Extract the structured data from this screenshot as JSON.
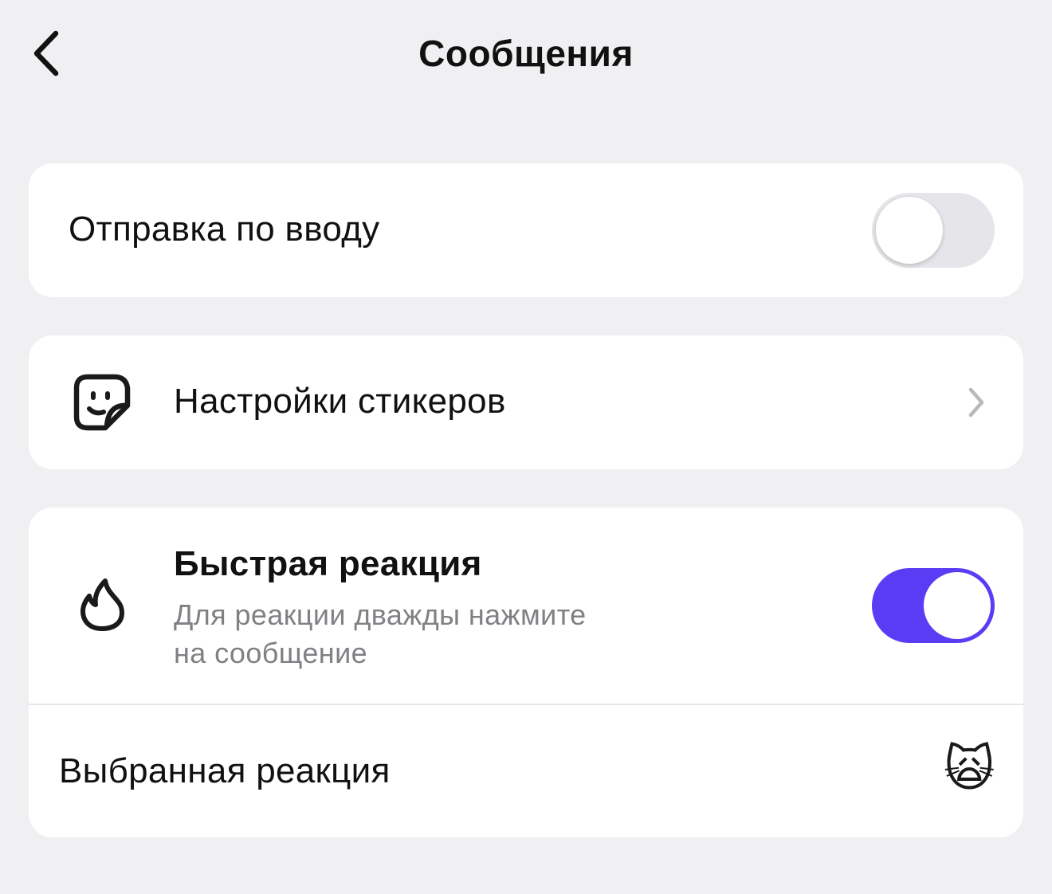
{
  "header": {
    "title": "Сообщения",
    "back_icon": "chevron-left-icon"
  },
  "send_on_enter": {
    "label": "Отправка по вводу",
    "enabled": false
  },
  "stickers": {
    "label": "Настройки стикеров",
    "icon": "sticker-icon",
    "chevron_icon": "chevron-right-icon"
  },
  "quick_reaction": {
    "label": "Быстрая реакция",
    "description_line1": "Для реакции дважды нажмите",
    "description_line2": "на сообщение",
    "icon": "flame-icon",
    "enabled": true
  },
  "selected_reaction": {
    "label": "Выбранная реакция",
    "value": "🙀"
  },
  "colors": {
    "background": "#f0f0f3",
    "card": "#ffffff",
    "accent": "#5b3cf5",
    "toggle_off": "#e5e5ea",
    "secondary_text": "#808085"
  }
}
